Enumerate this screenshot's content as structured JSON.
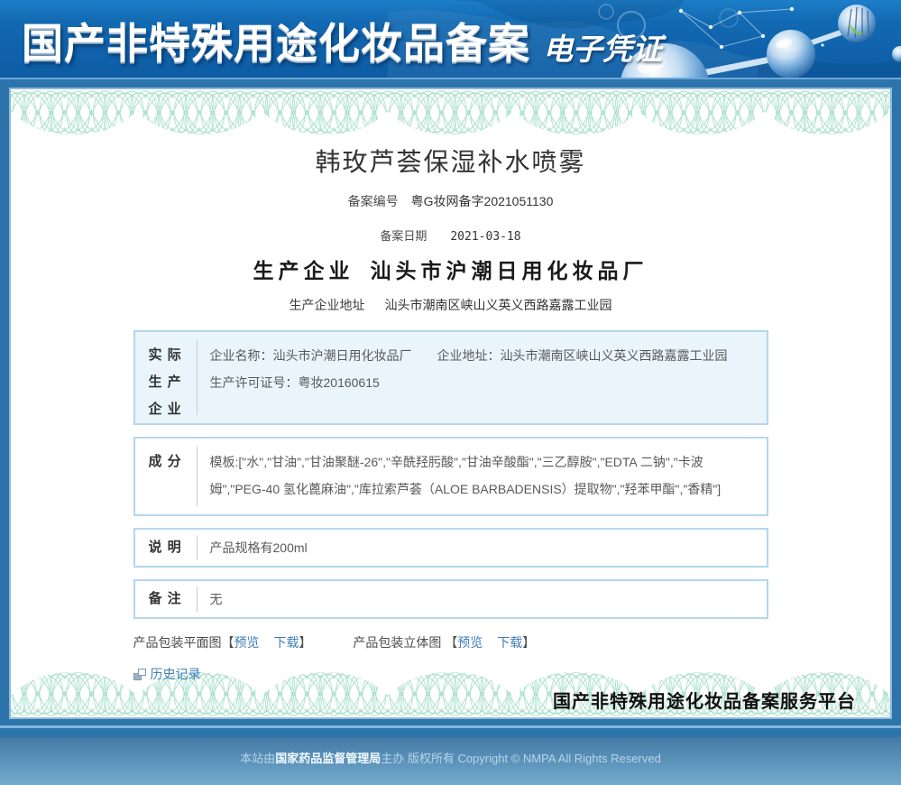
{
  "colors": {
    "page_bg": "#2d74ac",
    "header_blue_top": "#1d7ec8",
    "header_blue_bottom": "#0d5ca4",
    "link_blue": "#3d7dbd",
    "table_border": "#b3d7ec",
    "highlight_row_bg": "#e9f4fb",
    "guilloche_green": "#9edcc5",
    "footer_gradient_top": "#447ba6",
    "footer_gradient_bottom": "#74abcd"
  },
  "header": {
    "title": "国产非特殊用途化妆品备案",
    "subtitle": "电子凭证"
  },
  "certificate": {
    "product_name": "韩玫芦荟保湿补水喷雾",
    "record_number": {
      "label": "备案编号",
      "value": "粤G妆网备字2021051130"
    },
    "record_date": {
      "label": "备案日期",
      "value": "2021-03-18"
    },
    "manufacturer": {
      "label": "生产企业",
      "value": "汕头市沪潮日用化妆品厂"
    },
    "manufacturer_address": {
      "label": "生产企业地址",
      "value": "汕头市潮南区峡山义英义西路嘉露工业园"
    },
    "table": {
      "rows": [
        {
          "label": "实 际\n生 产\n企 业",
          "content": "企业名称：汕头市沪潮日用化妆品厂　　企业地址：汕头市潮南区峡山义英义西路嘉露工业园　　生产许可证号：粤妆20160615"
        },
        {
          "label": "成 分",
          "content": "模板:[\"水\",\"甘油\",\"甘油聚醚-26\",\"辛酰羟肟酸\",\"甘油辛酸酯\",\"三乙醇胺\",\"EDTA 二钠\",\"卡波姆\",\"PEG-40 氢化蓖麻油\",\"库拉索芦荟（ALOE BARBADENSIS）提取物\",\"羟苯甲酯\",\"香精\"]"
        },
        {
          "label": "说 明",
          "content": "产品规格有200ml"
        },
        {
          "label": "备 注",
          "content": "无"
        }
      ]
    },
    "attachments": {
      "flat_label": "产品包装平面图",
      "stereo_label": "产品包装立体图",
      "bracket_open": "【",
      "bracket_close": "】",
      "preview": "预览",
      "download": "下载"
    },
    "history_label": "历史记录",
    "platform": "国产非特殊用途化妆品备案服务平台"
  },
  "footer": {
    "prefix": "本站由",
    "authority": "国家药品监督管理局",
    "suffix": "主办 版权所有 Copyright © NMPA All Rights Reserved"
  }
}
